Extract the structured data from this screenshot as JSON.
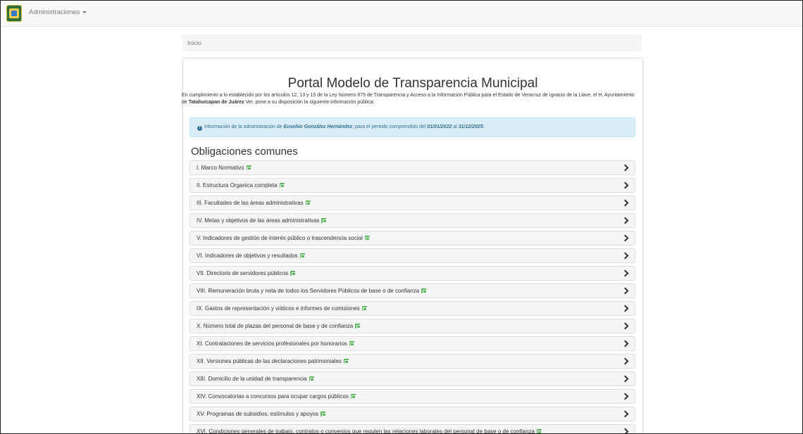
{
  "navbar": {
    "menu_label": "Administraciones"
  },
  "breadcrumb": {
    "home": "Inicio"
  },
  "portal": {
    "title": "Portal Modelo de Transparencia Municipal",
    "intro_pre": "En cumplimiento a lo establecido por los artículos 12, 13 y 15 de la Ley Número 875 de Transparencia y Acceso a la Información Pública para el Estado de Veracruz de Ignacio de la Llave, el H. Ayuntamiento de ",
    "intro_bold": "Tatahuicapan de Juárez",
    "intro_post": " Ver. pone a su disposición la siguiente información pública:",
    "info_pre": "Información de la administración de ",
    "info_name": "Eusebio González Hernández",
    "info_mid": ", para el periodo comprendido del ",
    "info_start": "01/01/2022",
    "info_and": " al ",
    "info_end": "31/12/2025",
    "info_tail": "."
  },
  "section": {
    "title": "Obligaciones comunes"
  },
  "obligations": [
    "I. Marco Normativo",
    "II. Estructura Organica completa",
    "III. Facultades de las áreas administrativas",
    "IV. Metas y objetivos de las áreas administrativas",
    "V. Indicadores de gestión de interés público o trascendencia social",
    "VI. Indicadores de objetivos y resultados",
    "VII. Directorio de servidores públicos",
    "VIII. Remuneración bruta y neta de todos los Servidores Públicos de base o de confianza",
    "IX. Gastos de representación y viáticos e informes de comisiones",
    "X. Número total de plazas del personal de base y de confianza",
    "XI. Contrataciones de servicios profesionales por honorarios",
    "XII. Versiones públicas de las declaraciones patrimoniales",
    "XIII. Domicilio de la unidad de transparencia",
    "XIV. Convocatorias a concursos para ocupar cargos públicos",
    "XV. Programas de subsidios, estímulos y apoyos",
    "XVI. Condiciones generales de trabajo, contratos o convenios que regulen las relaciones laborales del personal de base o de confianza"
  ],
  "colors": {
    "badge": "#5cb85c",
    "info_bg": "#d9edf7",
    "info_text": "#31708f"
  },
  "icons": {
    "logo": "municipal-seal-icon",
    "info": "info-circle-icon",
    "badge": "external-link-icon",
    "chevron": "chevron-right-icon"
  }
}
